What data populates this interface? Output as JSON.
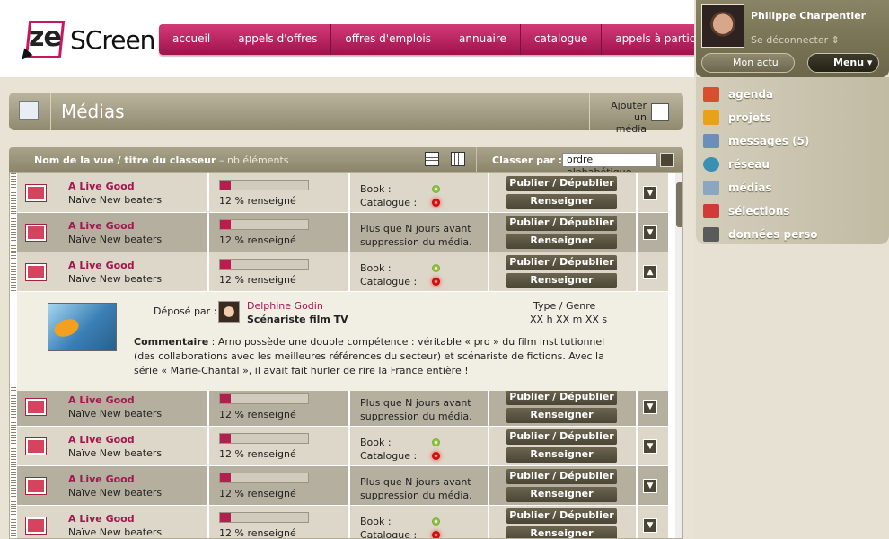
{
  "brand": {
    "logo_ze": "ze",
    "logo_screen": "SCreen"
  },
  "nav": [
    "accueil",
    "appels d'offres",
    "offres d'emplois",
    "annuaire",
    "catalogue",
    "appels à participation"
  ],
  "user": {
    "name": "Philippe Charpentier",
    "logout": "Se déconnecter ⇕",
    "actu_label": "Mon actu",
    "menu_label": "Menu ▾"
  },
  "side_menu": [
    {
      "label": "agenda",
      "icon": "calendar-icon",
      "color": "#d94f2d"
    },
    {
      "label": "projets",
      "icon": "briefcase-icon",
      "color": "#e8a21a"
    },
    {
      "label": "messages (5)",
      "icon": "envelope-icon",
      "color": "#6b8fb8"
    },
    {
      "label": "réseau",
      "icon": "globe-icon",
      "color": "#3a8fb5"
    },
    {
      "label": "médias",
      "icon": "media-icon",
      "color": "#8aa6c0"
    },
    {
      "label": "sélections",
      "icon": "pin-icon",
      "color": "#d23a3a"
    },
    {
      "label": "données perso",
      "icon": "id-card-icon",
      "color": "#5a5a5a"
    }
  ],
  "page": {
    "title": "Médias",
    "add_label": "Ajouter un média"
  },
  "viewbar": {
    "title": "Nom de la vue / titre du classeur",
    "count": " – nb éléments",
    "sort_label": "Classer par :",
    "sort_value": "ordre alphabétique"
  },
  "rows": [
    {
      "title": "A Live Good",
      "subtitle": "Naïve New beaters",
      "progress": 12,
      "progress_label": "12 % renseigné",
      "kind": "status",
      "book": "Book :",
      "catalogue": "Catalogue :",
      "btn1": "Publier / Dépublier",
      "btn2": "Renseigner",
      "toggle": "▼",
      "shade": "light"
    },
    {
      "title": "A Live Good",
      "subtitle": "Naïve New beaters",
      "progress": 12,
      "progress_label": "12 % renseigné",
      "kind": "notice",
      "notice1": "Plus que N jours avant",
      "notice2": "suppression du média.",
      "btn1": "Publier / Dépublier",
      "btn2": "Renseigner",
      "toggle": "▼",
      "shade": "dark"
    },
    {
      "title": "A Live Good",
      "subtitle": "Naïve New beaters",
      "progress": 12,
      "progress_label": "12 % renseigné",
      "kind": "status",
      "book": "Book :",
      "catalogue": "Catalogue :",
      "btn1": "Publier / Dépublier",
      "btn2": "Renseigner",
      "toggle": "▲",
      "shade": "light"
    },
    {
      "title": "A Live Good",
      "subtitle": "Naïve New beaters",
      "progress": 12,
      "progress_label": "12 % renseigné",
      "kind": "notice",
      "notice1": "Plus que N jours avant",
      "notice2": "suppression du média.",
      "btn1": "Publier / Dépublier",
      "btn2": "Renseigner",
      "toggle": "▼",
      "shade": "dark"
    },
    {
      "title": "A Live Good",
      "subtitle": "Naïve New beaters",
      "progress": 12,
      "progress_label": "12 % renseigné",
      "kind": "status",
      "book": "Book :",
      "catalogue": "Catalogue :",
      "btn1": "Publier / Dépublier",
      "btn2": "Renseigner",
      "toggle": "▼",
      "shade": "light"
    },
    {
      "title": "A Live Good",
      "subtitle": "Naïve New beaters",
      "progress": 12,
      "progress_label": "12 % renseigné",
      "kind": "notice",
      "notice1": "Plus que N jours avant",
      "notice2": "suppression du média.",
      "btn1": "Publier / Dépublier",
      "btn2": "Renseigner",
      "toggle": "▼",
      "shade": "dark"
    },
    {
      "title": "A Live Good",
      "subtitle": "Naïve New beaters",
      "progress": 12,
      "progress_label": "12 % renseigné",
      "kind": "status",
      "book": "Book :",
      "catalogue": "Catalogue :",
      "btn1": "Publier / Dépublier",
      "btn2": "Renseigner",
      "toggle": "▼",
      "shade": "light"
    }
  ],
  "detail": {
    "deposit_label": "Déposé par :",
    "depositor_name": "Delphine Godin",
    "depositor_role": "Scénariste film TV",
    "type_label": "Type / Genre",
    "type_value": "XX h XX m XX s",
    "comment_label": "Commentaire",
    "comment_text": " : Arno possède une double compétence : véritable « pro » du film institutionnel (des collaborations avec les meilleures références du secteur) et scénariste de fictions. Avec la série « Marie-Chantal », il avait fait hurler de rire la France entière !"
  }
}
